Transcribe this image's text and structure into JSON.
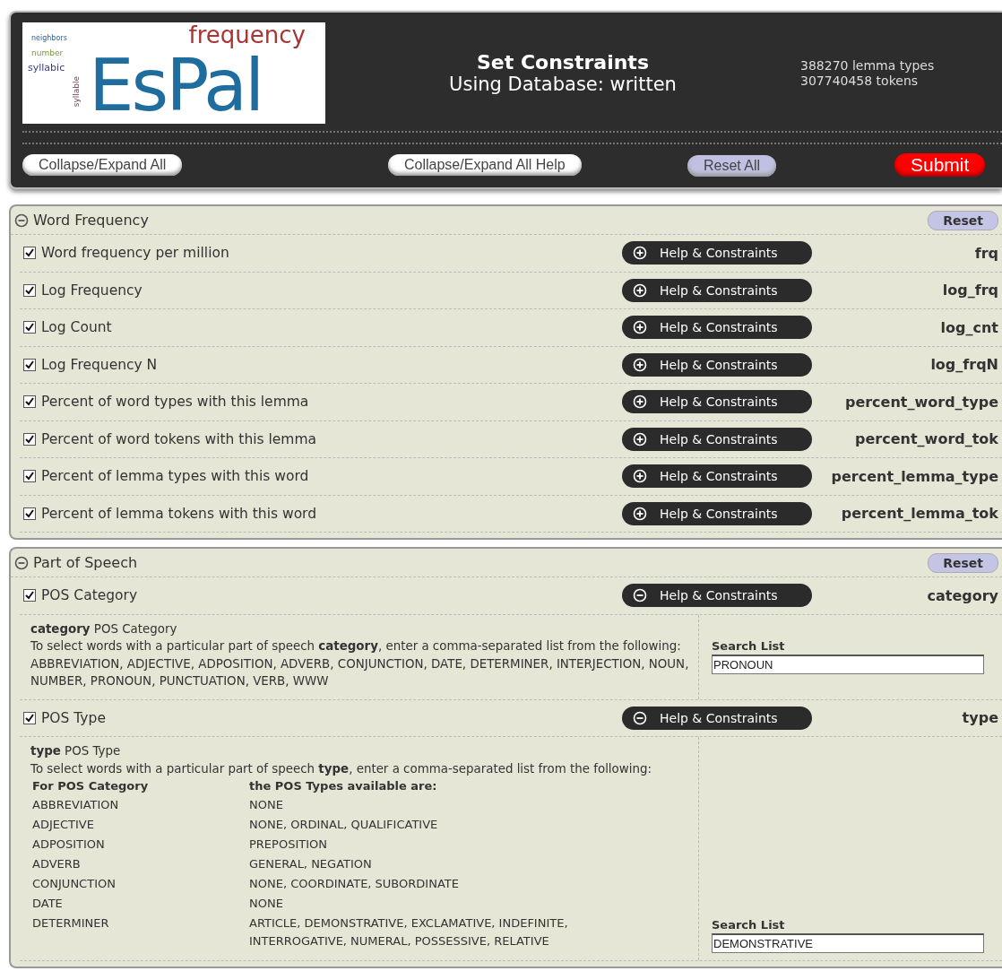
{
  "header": {
    "logo": {
      "title": "EsPal",
      "words": [
        "neighbors",
        "frequency",
        "number",
        "syllabic",
        "syllable"
      ]
    },
    "title": "Set Constraints",
    "subtitle": "Using Database: written",
    "stats": [
      "388270 lemma types",
      "307740458 tokens"
    ],
    "buttons": [
      {
        "label": "Collapse/Expand All",
        "kind": "plain"
      },
      {
        "label": "Collapse/Expand All Help",
        "kind": "plain"
      },
      {
        "label": "Reset All",
        "kind": "reset"
      },
      {
        "label": "Submit",
        "kind": "submit"
      }
    ]
  },
  "sections": [
    {
      "title": "Word Frequency",
      "expanded": true,
      "reset": "Reset",
      "fields": [
        {
          "label": "Word frequency per million",
          "checked": true,
          "help_button": "Help & Constraints",
          "help_expanded": false,
          "code": "frq"
        },
        {
          "label": "Log Frequency",
          "checked": true,
          "help_button": "Help & Constraints",
          "help_expanded": false,
          "code": "log_frq"
        },
        {
          "label": "Log Count",
          "checked": true,
          "help_button": "Help & Constraints",
          "help_expanded": false,
          "code": "log_cnt"
        },
        {
          "label": "Log Frequency N",
          "checked": true,
          "help_button": "Help & Constraints",
          "help_expanded": false,
          "code": "log_frqN"
        },
        {
          "label": "Percent of word types with this lemma",
          "checked": true,
          "help_button": "Help & Constraints",
          "help_expanded": false,
          "code": "percent_word_type"
        },
        {
          "label": "Percent of word tokens with this lemma",
          "checked": true,
          "help_button": "Help & Constraints",
          "help_expanded": false,
          "code": "percent_word_tok"
        },
        {
          "label": "Percent of lemma types with this word",
          "checked": true,
          "help_button": "Help & Constraints",
          "help_expanded": false,
          "code": "percent_lemma_type"
        },
        {
          "label": "Percent of lemma tokens with this word",
          "checked": true,
          "help_button": "Help & Constraints",
          "help_expanded": false,
          "code": "percent_lemma_tok"
        }
      ]
    },
    {
      "title": "Part of Speech",
      "expanded": true,
      "reset": "Reset",
      "fields": [
        {
          "label": "POS Category",
          "checked": true,
          "help_button": "Help & Constraints",
          "help_expanded": true,
          "code": "category",
          "help": {
            "heading": "**category** POS Category",
            "text": "To select words with a particular part of speech **category**, enter a comma-separated list from the following: ABBREVIATION, ADJECTIVE, ADPOSITION, ADVERB, CONJUNCTION, DATE, DETERMINER, INTERJECTION, NOUN, NUMBER, PRONOUN, PUNCTUATION, VERB, WWW",
            "search_label": "Search List",
            "search_value": "PRONOUN"
          }
        },
        {
          "label": "POS Type",
          "checked": true,
          "help_button": "Help & Constraints",
          "help_expanded": true,
          "code": "type",
          "help": {
            "heading": "**type** POS Type",
            "text": "To select words with a particular part of speech **type**, enter a comma-separated list from the following:",
            "table": {
              "columns": [
                "For POS Category",
                "the POS Types available are:"
              ],
              "rows": [
                [
                  "ABBREVIATION",
                  "NONE"
                ],
                [
                  "ADJECTIVE",
                  "NONE, ORDINAL, QUALIFICATIVE"
                ],
                [
                  "ADPOSITION",
                  "PREPOSITION"
                ],
                [
                  "ADVERB",
                  "GENERAL, NEGATION"
                ],
                [
                  "CONJUNCTION",
                  "NONE, COORDINATE, SUBORDINATE"
                ],
                [
                  "DATE",
                  "NONE"
                ],
                [
                  "DETERMINER",
                  "ARTICLE, DEMONSTRATIVE, EXCLAMATIVE, INDEFINITE, INTERROGATIVE, NUMERAL, POSSESSIVE, RELATIVE"
                ]
              ]
            },
            "search_label": "Search List",
            "search_value": "DEMONSTRATIVE"
          }
        }
      ]
    }
  ]
}
